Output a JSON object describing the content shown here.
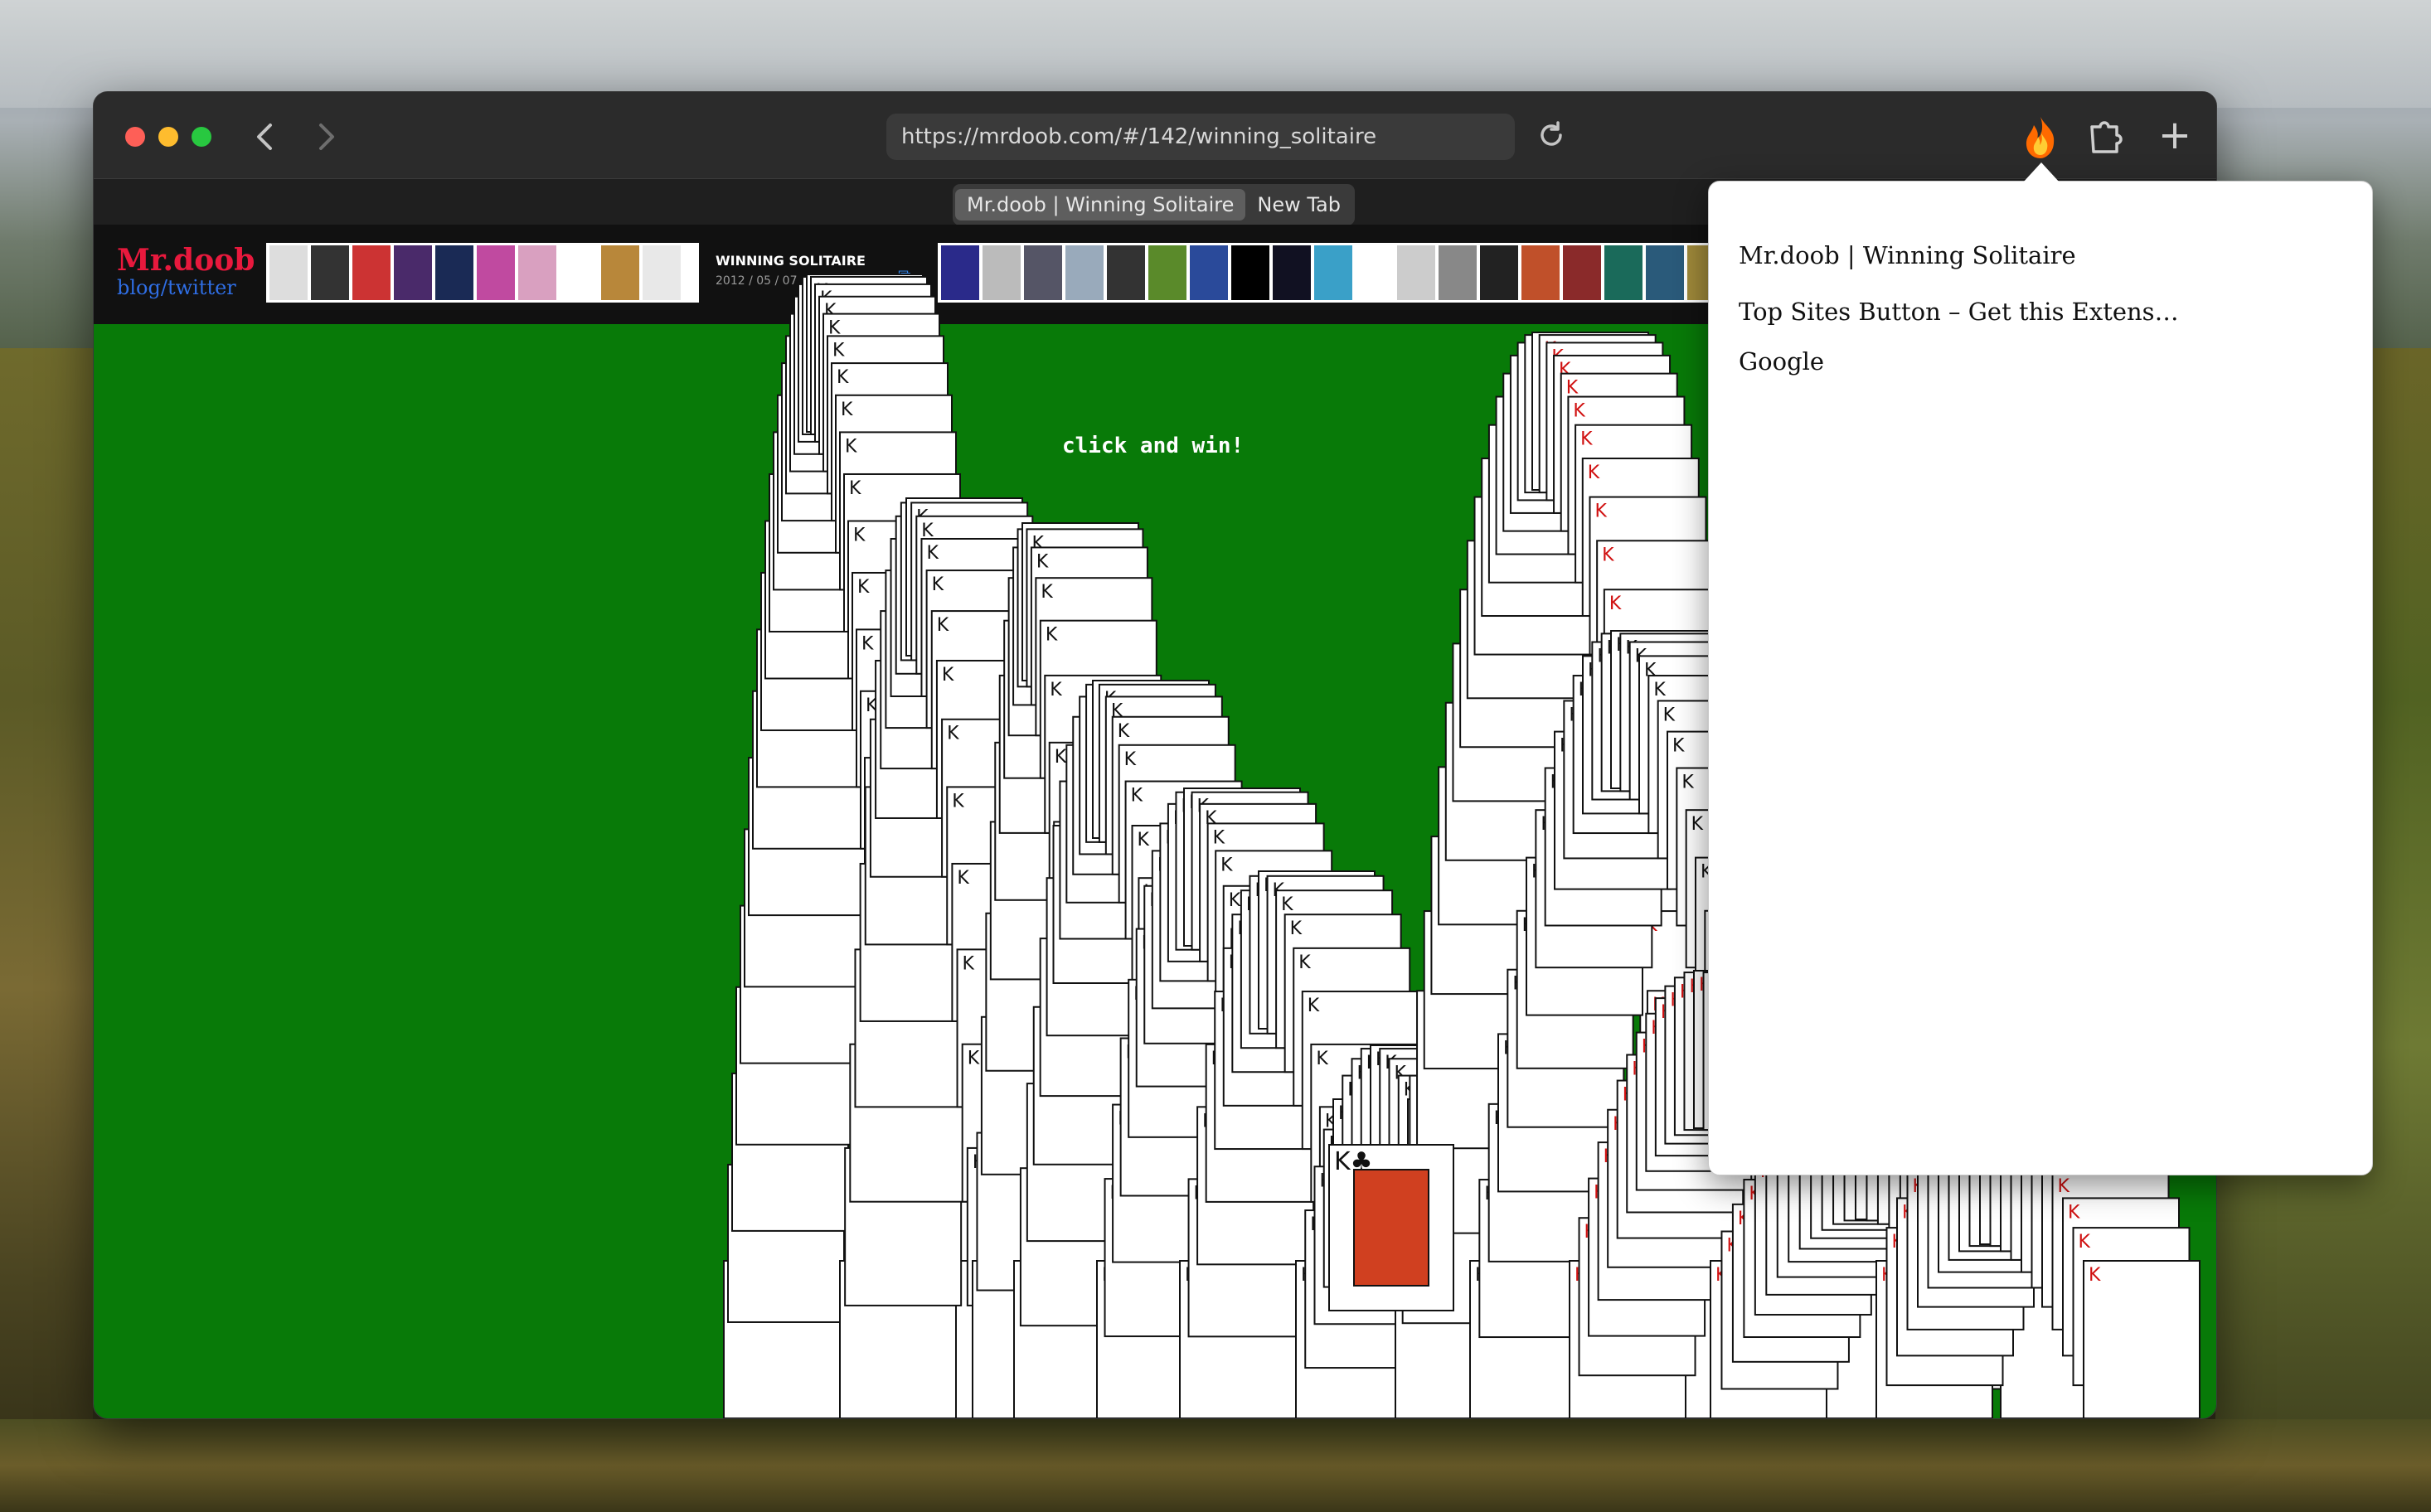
{
  "browser": {
    "url": "https://mrdoob.com/#/142/winning_solitaire",
    "tabs": [
      {
        "label": "Mr.doob | Winning Solitaire",
        "active": true
      },
      {
        "label": "New Tab",
        "active": false
      }
    ],
    "icons": [
      "chevron-left-icon",
      "chevron-right-icon",
      "reload-icon",
      "fire-extension-icon",
      "puzzle-extension-icon",
      "plus-icon"
    ]
  },
  "site": {
    "logo_line1": "Mr.doob",
    "logo_line2": "blog/twitter",
    "entry_title": "WINNING SOLITAIRE",
    "entry_date": "2012 / 05 / 07",
    "canvas_text": "click and win!",
    "background_color": "#087a08"
  },
  "popup": {
    "items": [
      {
        "label": "Mr.doob | Winning Solitaire"
      },
      {
        "label": "Top Sites Button – Get this Extens…"
      },
      {
        "label": "Google"
      }
    ]
  }
}
